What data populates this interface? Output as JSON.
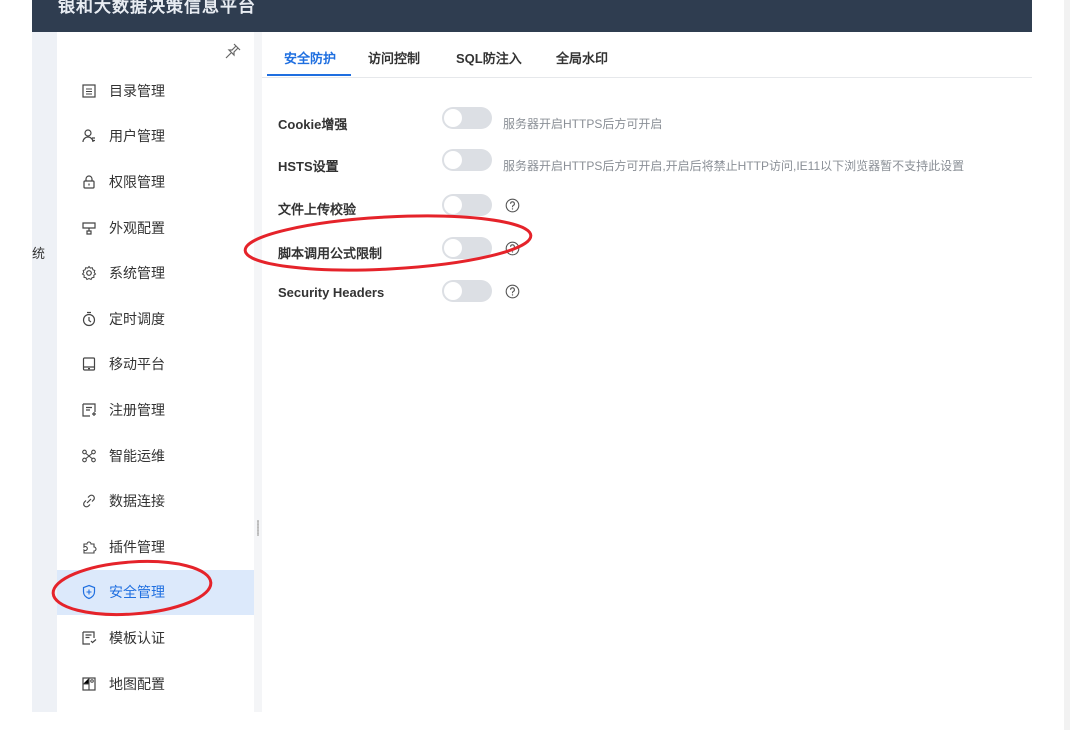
{
  "header": {
    "title": "银和大数据决策信息平台"
  },
  "left_strip": {
    "label": "统"
  },
  "sidebar": {
    "items": [
      {
        "label": "目录管理",
        "icon": "list-icon"
      },
      {
        "label": "用户管理",
        "icon": "user-icon"
      },
      {
        "label": "权限管理",
        "icon": "lock-icon"
      },
      {
        "label": "外观配置",
        "icon": "appearance-icon"
      },
      {
        "label": "系统管理",
        "icon": "gear-icon"
      },
      {
        "label": "定时调度",
        "icon": "timer-icon"
      },
      {
        "label": "移动平台",
        "icon": "mobile-icon"
      },
      {
        "label": "注册管理",
        "icon": "register-icon"
      },
      {
        "label": "智能运维",
        "icon": "ops-icon"
      },
      {
        "label": "数据连接",
        "icon": "link-icon"
      },
      {
        "label": "插件管理",
        "icon": "puzzle-icon"
      },
      {
        "label": "安全管理",
        "icon": "shield-icon",
        "active": true
      },
      {
        "label": "模板认证",
        "icon": "template-icon"
      },
      {
        "label": "地图配置",
        "icon": "map-icon"
      }
    ]
  },
  "tabs": [
    {
      "label": "安全防护",
      "active": true
    },
    {
      "label": "访问控制"
    },
    {
      "label": "SQL防注入"
    },
    {
      "label": "全局水印"
    }
  ],
  "settings": [
    {
      "label": "Cookie增强",
      "enabled": false,
      "hint": "服务器开启HTTPS后方可开启"
    },
    {
      "label": "HSTS设置",
      "enabled": false,
      "hint": "服务器开启HTTPS后方可开启,开启后将禁止HTTP访问,IE11以下浏览器暂不支持此设置"
    },
    {
      "label": "文件上传校验",
      "enabled": false,
      "help": "help-icon"
    },
    {
      "label": "脚本调用公式限制",
      "enabled": false,
      "help": "help-icon"
    },
    {
      "label": "Security Headers",
      "enabled": false,
      "help": "help-icon"
    }
  ],
  "colors": {
    "accent": "#1f6fe0",
    "header_bg": "#2f3d50",
    "active_bg": "#dce9fb",
    "annotation": "#e5232a",
    "toggle_off": "#dcdfe4"
  }
}
